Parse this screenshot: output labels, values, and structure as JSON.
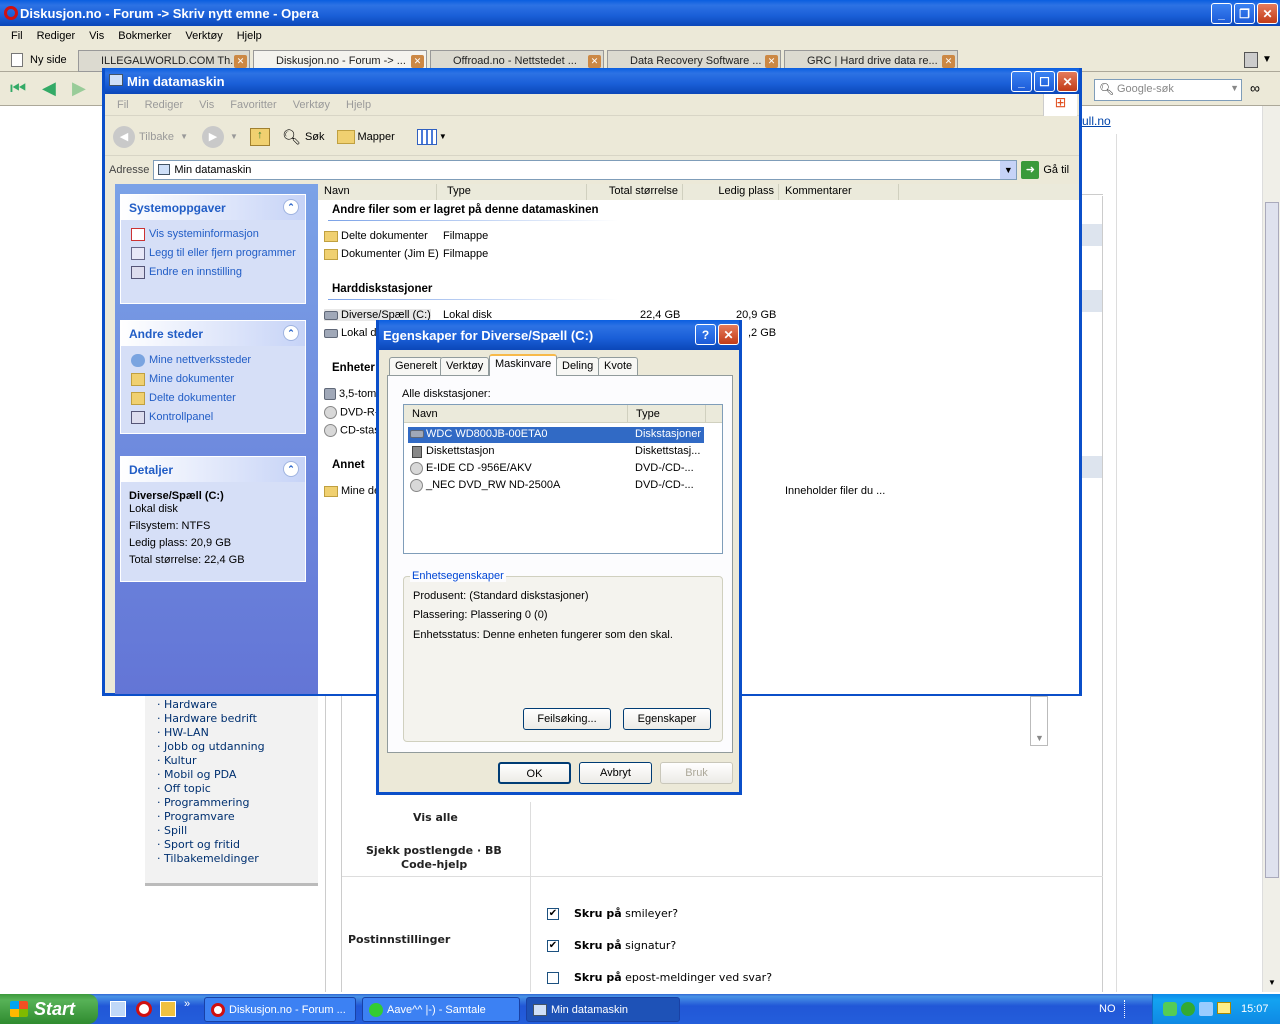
{
  "opera": {
    "title": "Diskusjon.no - Forum -> Skriv nytt emne - Opera",
    "menu": [
      "Fil",
      "Rediger",
      "Vis",
      "Bokmerker",
      "Verktøy",
      "Hjelp"
    ],
    "new_tab": "Ny side",
    "tabs": [
      "ILLEGALWORLD.COM Th...",
      "Diskusjon.no - Forum -> ...",
      "Offroad.no - Nettstedet ...",
      "Data Recovery Software ...",
      "GRC | Hard drive data re..."
    ],
    "search_placeholder": "Google-søk",
    "link_fragment": "ull.no"
  },
  "forum": {
    "categories": [
      "· Hardware",
      "· Hardware bedrift",
      "· HW-LAN",
      "· Jobb og utdanning",
      "· Kultur",
      "· Mobil og PDA",
      "· Off topic",
      "· Programmering",
      "· Programvare",
      "· Spill",
      "· Sport og fritid",
      "· Tilbakemeldinger"
    ],
    "show_all": "Vis alle",
    "check_length": "Sjekk postlengde · BB",
    "code_help": "Code-hjelp",
    "post_settings": "Postinnstillinger",
    "options": [
      {
        "bold": "Skru på",
        "rest": "smileyer?",
        "checked": true
      },
      {
        "bold": "Skru på",
        "rest": "signatur?",
        "checked": true
      },
      {
        "bold": "Skru på",
        "rest": "epost-meldinger ved svar?",
        "checked": false
      }
    ]
  },
  "explorer": {
    "title": "Min datamaskin",
    "menu": [
      "Fil",
      "Rediger",
      "Vis",
      "Favoritter",
      "Verktøy",
      "Hjelp"
    ],
    "toolbar": {
      "back": "Tilbake",
      "search": "Søk",
      "folders": "Mapper"
    },
    "address_label": "Adresse",
    "address_value": "Min datamaskin",
    "go": "Gå til",
    "system_tasks": {
      "title": "Systemoppgaver",
      "items": [
        "Vis systeminformasjon",
        "Legg til eller fjern programmer",
        "Endre en innstilling"
      ]
    },
    "other_places": {
      "title": "Andre steder",
      "items": [
        "Mine nettverkssteder",
        "Mine dokumenter",
        "Delte dokumenter",
        "Kontrollpanel"
      ]
    },
    "details": {
      "title": "Detaljer",
      "name": "Diverse/Spæll (C:)",
      "type": "Lokal disk",
      "fs": "Filsystem: NTFS",
      "free": "Ledig plass: 20,9 GB",
      "total": "Total størrelse: 22,4 GB"
    },
    "columns": [
      "Navn",
      "Type",
      "Total størrelse",
      "Ledig plass",
      "Kommentarer"
    ],
    "groups": {
      "other_files": "Andre filer som er lagret på denne datamaskinen",
      "hard_drives": "Harddiskstasjoner",
      "devices": "Enheter",
      "other": "Annet"
    },
    "files": [
      {
        "name": "Delte dokumenter",
        "type": "Filmappe"
      },
      {
        "name": "Dokumenter (Jim E)",
        "type": "Filmappe"
      }
    ],
    "drives": [
      {
        "name": "Diverse/Spæll (C:)",
        "type": "Lokal disk",
        "total": "22,4 GB",
        "free": "20,9 GB"
      },
      {
        "name": "Lokal dis",
        "free": ",2 GB"
      }
    ],
    "devices": [
      "3,5-tomm",
      "DVD-R-s",
      "CD-stas"
    ],
    "other_items": [
      {
        "name": "Mine del",
        "comment": "Inneholder filer du ..."
      }
    ]
  },
  "dialog": {
    "title": "Egenskaper for Diverse/Spæll (C:)",
    "tabs": [
      "Generelt",
      "Verktøy",
      "Maskinvare",
      "Deling",
      "Kvote"
    ],
    "all_drives": "Alle diskstasjoner:",
    "columns": [
      "Navn",
      "Type"
    ],
    "drives": [
      {
        "name": "WDC WD800JB-00ETA0",
        "type": "Diskstasjoner"
      },
      {
        "name": "Diskettstasjon",
        "type": "Diskettstasj..."
      },
      {
        "name": "E-IDE CD -956E/AKV",
        "type": "DVD-/CD-..."
      },
      {
        "name": "_NEC DVD_RW ND-2500A",
        "type": "DVD-/CD-..."
      }
    ],
    "props_title": "Enhetsegenskaper",
    "manufacturer": "Produsent: (Standard diskstasjoner)",
    "location": "Plassering: Plassering 0 (0)",
    "status": "Enhetsstatus: Denne enheten fungerer som den skal.",
    "troubleshoot": "Feilsøking...",
    "properties": "Egenskaper",
    "ok": "OK",
    "cancel": "Avbryt",
    "apply": "Bruk"
  },
  "taskbar": {
    "start": "Start",
    "items": [
      "Diskusjon.no - Forum ...",
      "Aave^^ |-) - Samtale",
      "Min datamaskin"
    ],
    "lang": "NO",
    "clock": "15:07"
  }
}
